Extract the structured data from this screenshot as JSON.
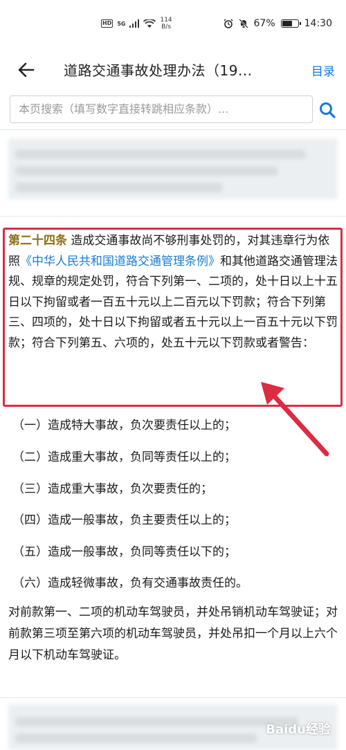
{
  "status_bar": {
    "hd_badge": "HD",
    "network": "5G",
    "speed_value": "114",
    "speed_unit": "B/s",
    "battery_percent": "67%",
    "battery_level": 0.67,
    "time": "14:30"
  },
  "header": {
    "title": "道路交通事故处理办法（19...",
    "toc_label": "目录"
  },
  "search": {
    "placeholder": "本页搜索（填写数字直接转跳相应条款）..."
  },
  "article": {
    "number": "第二十四条",
    "text_before_link": " 造成交通事故尚不够刑事处罚的，对其违章行为依照",
    "link_text": "《中华人民共和国道路交通管理条例》",
    "text_after_link": "和其他道路交通管理法规、规章的规定处罚，符合下列第一、二项的，处十日以上十五日以下拘留或者一百五十元以上二百元以下罚款；符合下列第三、四项的，处十日以下拘留或者五十元以上一百五十元以下罚款；符合下列第五、六项的，处五十元以下罚款或者警告："
  },
  "items": [
    "（一）造成特大事故，负次要责任以上的；",
    "（二）造成重大事故，负同等责任以上的；",
    "（三）造成重大事故，负次要责任的；",
    "（四）造成一般事故，负主要责任以上的；",
    "（五）造成一般事故，负同等责任以下的；",
    "（六）造成轻微事故，负有交通事故责任的。"
  ],
  "note": "对前款第一、二项的机动车驾驶员，并处吊销机动车驾驶证；对前款第三项至第六项的机动车驾驶员，并处吊扣一个月以上六个月以下机动车驾驶证。",
  "watermark": "Baidu经验",
  "colors": {
    "article_number": "#8b6d17",
    "link": "#1a7bd1",
    "accent": "#1677d6",
    "highlight": "#dc2b42"
  }
}
